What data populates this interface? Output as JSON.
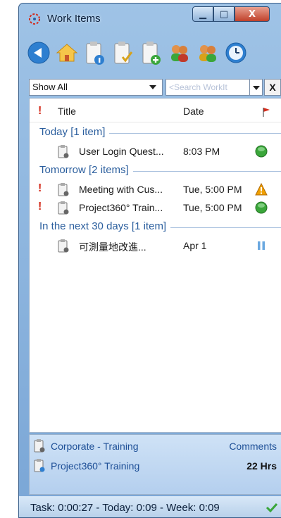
{
  "window": {
    "title": "Work Items",
    "minimize": "▁",
    "maximize": "□",
    "close": "X"
  },
  "toolbar": {
    "buttons": [
      "back-icon",
      "home-icon",
      "task-info-icon",
      "task-check-icon",
      "task-add-icon",
      "users-icon",
      "users-gold-icon",
      "clock-icon"
    ]
  },
  "filter": {
    "selected": "Show All",
    "search_placeholder": "<Search WorkIt",
    "clear": "X"
  },
  "list": {
    "columns": {
      "title": "Title",
      "date": "Date"
    },
    "groups": [
      {
        "label": "Today [1 item]",
        "rows": [
          {
            "priority": "",
            "title": "User Login Quest...",
            "date": "8:03 PM",
            "status": "green"
          }
        ]
      },
      {
        "label": "Tomorrow [2 items]",
        "rows": [
          {
            "priority": "!",
            "title": "Meeting with Cus...",
            "date": "Tue, 5:00 PM",
            "status": "warning"
          },
          {
            "priority": "!",
            "title": "Project360° Train...",
            "date": "Tue, 5:00 PM",
            "status": "green"
          }
        ]
      },
      {
        "label": "In the next 30 days [1 item]",
        "rows": [
          {
            "priority": "",
            "title": "可測量地改進...",
            "date": "Apr 1",
            "status": "pause"
          }
        ]
      }
    ]
  },
  "bottom": {
    "rows": [
      {
        "text": "Corporate - Training",
        "right": "Comments"
      },
      {
        "text": "Project360° Training",
        "right": "22 Hrs"
      }
    ]
  },
  "statusbar": {
    "text": "Task: 0:00:27 - Today: 0:09 - Week: 0:09"
  },
  "colors": {
    "accent": "#2c5f9e",
    "priority": "#d42a1a",
    "ok": "#3aa63a",
    "warning": "#f0a000"
  }
}
